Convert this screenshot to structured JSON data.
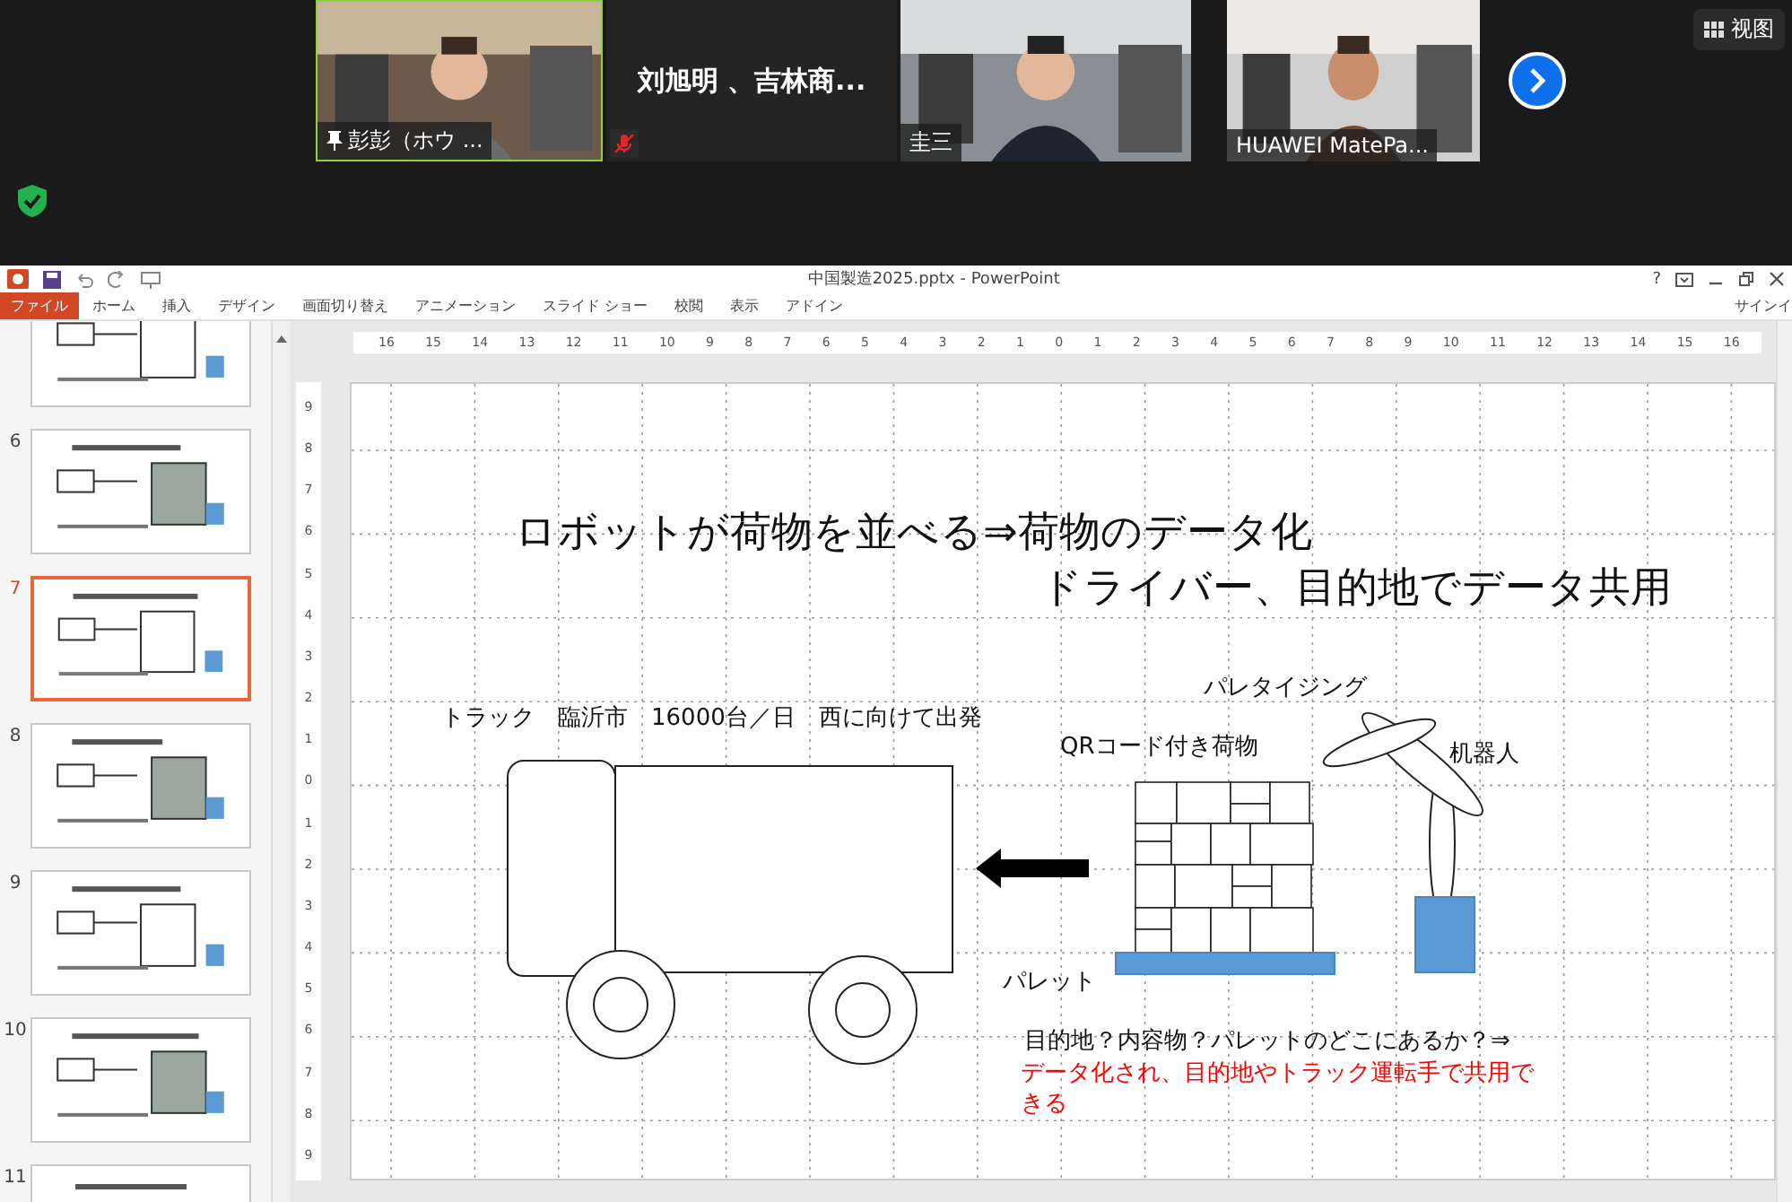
{
  "meeting": {
    "tiles": [
      {
        "kind": "video",
        "name": "彭彭（ホウ ...",
        "pinned": true,
        "muted": false,
        "active_speaker": true
      },
      {
        "kind": "name",
        "name": "刘旭明 、吉林商...",
        "pinned": false,
        "muted": true,
        "active_speaker": false
      },
      {
        "kind": "video",
        "name": "圭三",
        "pinned": false,
        "muted": false,
        "active_speaker": false
      },
      {
        "kind": "video",
        "name": "HUAWEI MatePa...",
        "pinned": false,
        "muted": false,
        "active_speaker": false
      }
    ],
    "view_button": "视图"
  },
  "powerpoint": {
    "title": "中国製造2025.pptx - PowerPoint",
    "help": "?",
    "file_tab": "ファイル",
    "tabs": [
      "ホーム",
      "挿入",
      "デザイン",
      "画面切り替え",
      "アニメーション",
      "スライド ショー",
      "校閲",
      "表示",
      "アドイン"
    ],
    "sign_in": "サインイ",
    "thumbnails": [
      {
        "selected": false
      },
      {
        "number": "6",
        "selected": false
      },
      {
        "number": "7",
        "selected": true
      },
      {
        "number": "8",
        "selected": false
      },
      {
        "number": "9",
        "selected": false
      },
      {
        "number": "10",
        "selected": false
      },
      {
        "number": "11",
        "selected": false
      }
    ],
    "ruler": {
      "horizontal": [
        "16",
        "15",
        "14",
        "13",
        "12",
        "11",
        "10",
        "9",
        "8",
        "7",
        "6",
        "5",
        "4",
        "3",
        "2",
        "1",
        "0",
        "1",
        "2",
        "3",
        "4",
        "5",
        "6",
        "7",
        "8",
        "9",
        "10",
        "11",
        "12",
        "13",
        "14",
        "15",
        "16"
      ],
      "vertical": [
        "9",
        "8",
        "7",
        "6",
        "5",
        "4",
        "3",
        "2",
        "1",
        "0",
        "1",
        "2",
        "3",
        "4",
        "5",
        "6",
        "7",
        "8",
        "9"
      ]
    },
    "slide": {
      "title_lines": [
        "ロボットが荷物を並べる⇒荷物のデータ化",
        "ドライバー、目的地でデータ共用"
      ],
      "truck_label": "トラック　臨沂市　16000台／日　西に向けて出発",
      "palletizing_label": "パレタイジング",
      "cargo_label": "QRコード付き荷物",
      "robot_label": "机器人",
      "pallet_label": "パレット",
      "question": "目的地？内容物？パレットのどこにあるか？⇒",
      "answer": "データ化され、目的地やトラック運転手で共用できる"
    }
  }
}
